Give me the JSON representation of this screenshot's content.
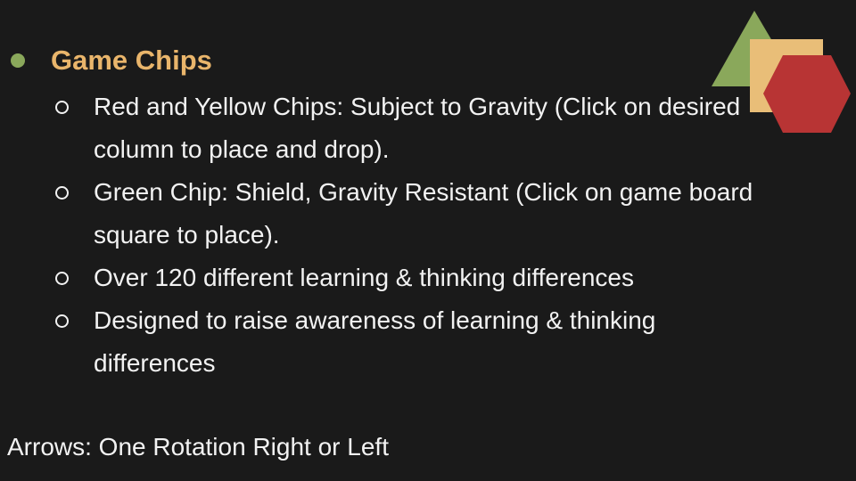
{
  "slide": {
    "heading": "Game Chips",
    "items": [
      "Red and Yellow Chips: Subject to Gravity (Click on desired column to place and drop).",
      "Green Chip: Shield, Gravity Resistant (Click on game board square to place).",
      "Over 120 different learning & thinking differences",
      "Designed to raise awareness of learning & thinking differences"
    ],
    "footer": "Arrows: One Rotation Right or Left"
  },
  "decoration": {
    "triangle_color": "#8aa85b",
    "square_color": "#e9be78",
    "hexagon_color": "#b83434",
    "icons": [
      "green-triangle-icon",
      "yellow-square-icon",
      "red-hexagon-icon"
    ]
  },
  "colors": {
    "background": "#1a1a1a",
    "heading": "#e9b56b",
    "heading_bullet": "#8aa85b",
    "text": "#f2f2f2"
  }
}
